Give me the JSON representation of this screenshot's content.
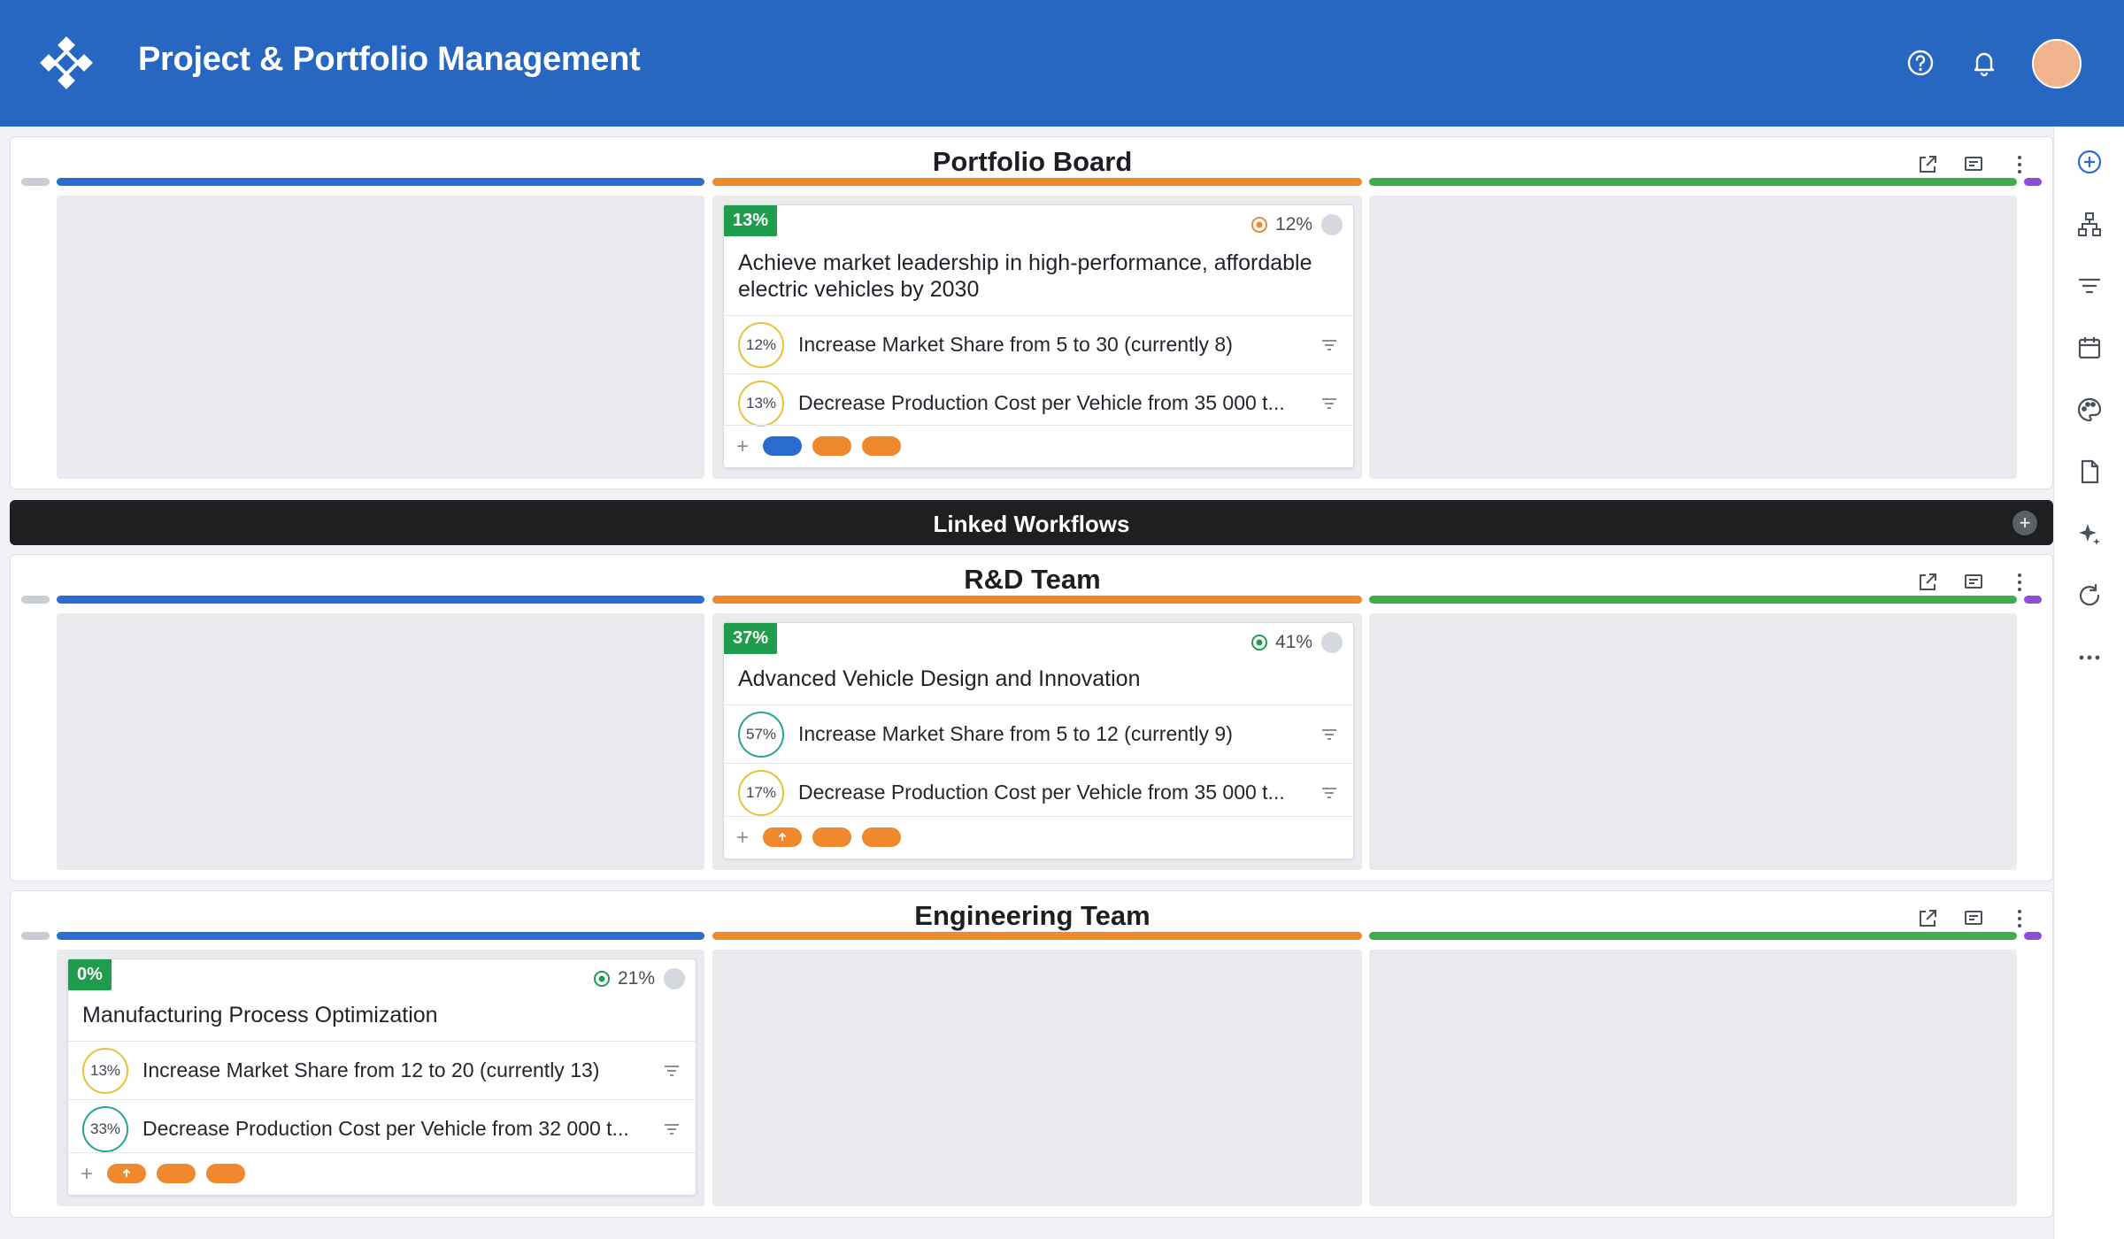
{
  "app": {
    "title": "Project & Portfolio Management"
  },
  "header_icons": [
    "help-icon",
    "bell-icon"
  ],
  "colors": {
    "header": "#2766c1",
    "badge": "#1f9d4c",
    "stripe_blue": "#2a6ccf",
    "stripe_orange": "#f0892d",
    "stripe_green": "#3cae4c",
    "stripe_purple": "#8a4fd6"
  },
  "rail_icons": [
    "add-circle-icon",
    "hierarchy-icon",
    "filter-icon",
    "calendar-icon",
    "palette-icon",
    "document-icon",
    "sparkle-icon",
    "refresh-icon",
    "more-icon"
  ],
  "linked": {
    "title": "Linked Workflows",
    "add": "+"
  },
  "boards": [
    {
      "title": "Portfolio Board",
      "card": {
        "badge": "13%",
        "score": "12%",
        "title_line1": "Achieve market leadership in high-performance, affordable",
        "title_line2": "electric vehicles by 2030",
        "krs": [
          {
            "pct": "12%",
            "text": "Increase Market Share from 5 to 30 (currently 8)"
          },
          {
            "pct": "13%",
            "text": "Decrease Production Cost per Vehicle from 35 000 t..."
          }
        ]
      }
    },
    {
      "title": "R&D Team",
      "card": {
        "badge": "37%",
        "score": "41%",
        "title_line1": "Advanced Vehicle Design and Innovation",
        "krs": [
          {
            "pct": "57%",
            "text": "Increase Market Share from 5 to 12 (currently 9)"
          },
          {
            "pct": "17%",
            "text": "Decrease Production Cost per Vehicle from 35 000 t..."
          }
        ]
      }
    },
    {
      "title": "Engineering Team",
      "card": {
        "badge": "0%",
        "score": "21%",
        "title_line1": "Manufacturing Process Optimization",
        "krs": [
          {
            "pct": "13%",
            "text": "Increase Market Share from 12 to 20 (currently 13)"
          },
          {
            "pct": "33%",
            "text": "Decrease Production Cost per Vehicle from 32 000 t..."
          }
        ]
      }
    }
  ]
}
